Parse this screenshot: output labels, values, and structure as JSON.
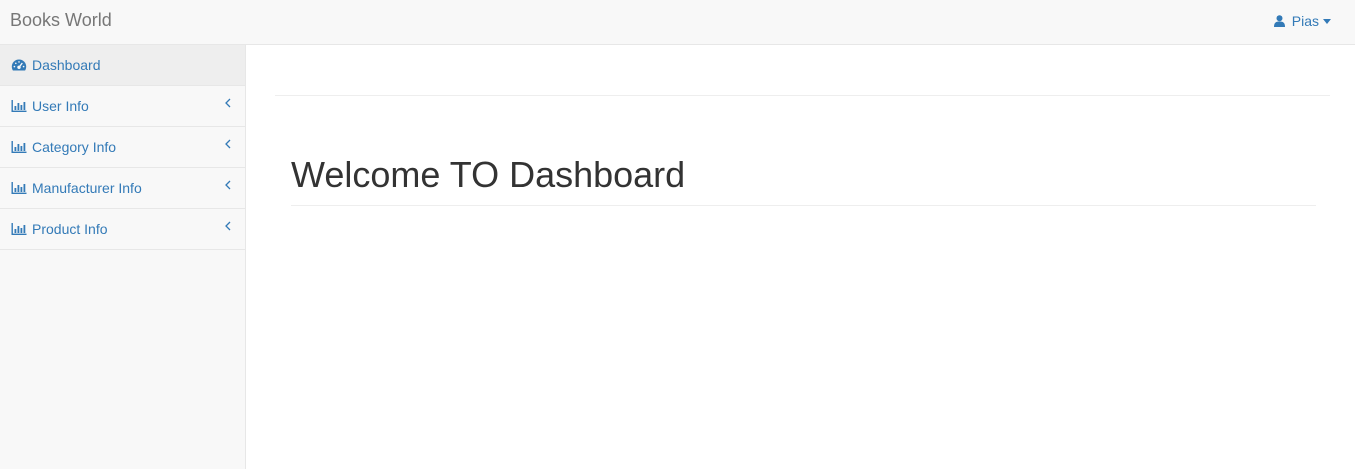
{
  "navbar": {
    "brand": "Books World",
    "user": {
      "name": "Pias",
      "icon": "user-icon"
    }
  },
  "sidebar": {
    "items": [
      {
        "label": "Dashboard",
        "icon": "dashboard-icon",
        "active": true
      },
      {
        "label": "User Info",
        "icon": "bar-chart-icon",
        "has_submenu": true
      },
      {
        "label": "Category Info",
        "icon": "bar-chart-icon",
        "has_submenu": true
      },
      {
        "label": "Manufacturer Info",
        "icon": "bar-chart-icon",
        "has_submenu": true
      },
      {
        "label": "Product Info",
        "icon": "bar-chart-icon",
        "has_submenu": true
      }
    ]
  },
  "main": {
    "heading": "Welcome TO Dashboard"
  },
  "colors": {
    "link": "#337ab7",
    "navbar_bg": "#f8f8f8",
    "brand": "#777777",
    "active_item_bg": "#eeeeee",
    "border": "#e7e7e7"
  }
}
